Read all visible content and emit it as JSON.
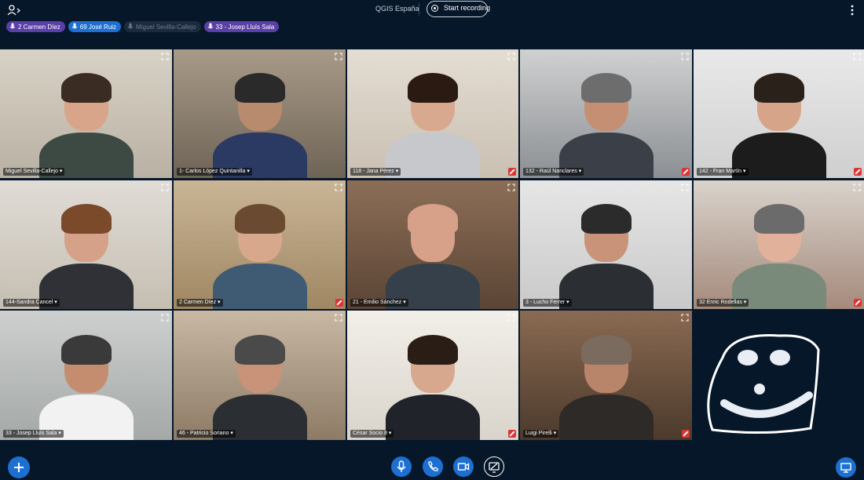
{
  "header": {
    "meeting_title": "QGIS España",
    "record_label": "Start recording"
  },
  "talking": [
    {
      "name": "2 Carmen Díez",
      "style": "purple"
    },
    {
      "name": "69 José Ruiz",
      "style": "blue"
    },
    {
      "name": "Miguel Sevilla-Callejo",
      "style": "dim"
    },
    {
      "name": "33 - Josep Lluís Sala",
      "style": "purple"
    }
  ],
  "participants": [
    {
      "name": "Miguel Sevilla-Callejo",
      "muted": false
    },
    {
      "name": "1- Carlos López Quintanilla",
      "muted": false
    },
    {
      "name": "118 - Jana Pérez",
      "muted": true
    },
    {
      "name": "132 - Raúl Nanclares",
      "muted": true
    },
    {
      "name": "142 - Fran Martín",
      "muted": true
    },
    {
      "name": "144-Sandra Cancel",
      "muted": false
    },
    {
      "name": "2 Carmen Díez",
      "muted": true
    },
    {
      "name": "21 - Emilio Sánchez",
      "muted": false
    },
    {
      "name": "3 - Lucho Ferrer",
      "muted": false
    },
    {
      "name": "32 Enric Rodellas",
      "muted": true
    },
    {
      "name": "33 - Josep Lluís Sala",
      "muted": false
    },
    {
      "name": "46 - Patricio Soriano",
      "muted": false
    },
    {
      "name": "César Socio 8",
      "muted": true
    },
    {
      "name": "Luigi Pirelli",
      "muted": true
    }
  ],
  "colors": {
    "background": "#06172a",
    "accent": "#1d6fd1",
    "talking_purple": "#5b3fa8",
    "muted_red": "#d33333"
  },
  "icons": {
    "users": "users-icon",
    "more": "more-vertical-icon",
    "mic": "mic-icon",
    "phone": "phone-icon",
    "camera": "camera-icon",
    "screenshare": "screenshare-icon",
    "plus": "plus-icon",
    "present": "presentation-icon"
  }
}
